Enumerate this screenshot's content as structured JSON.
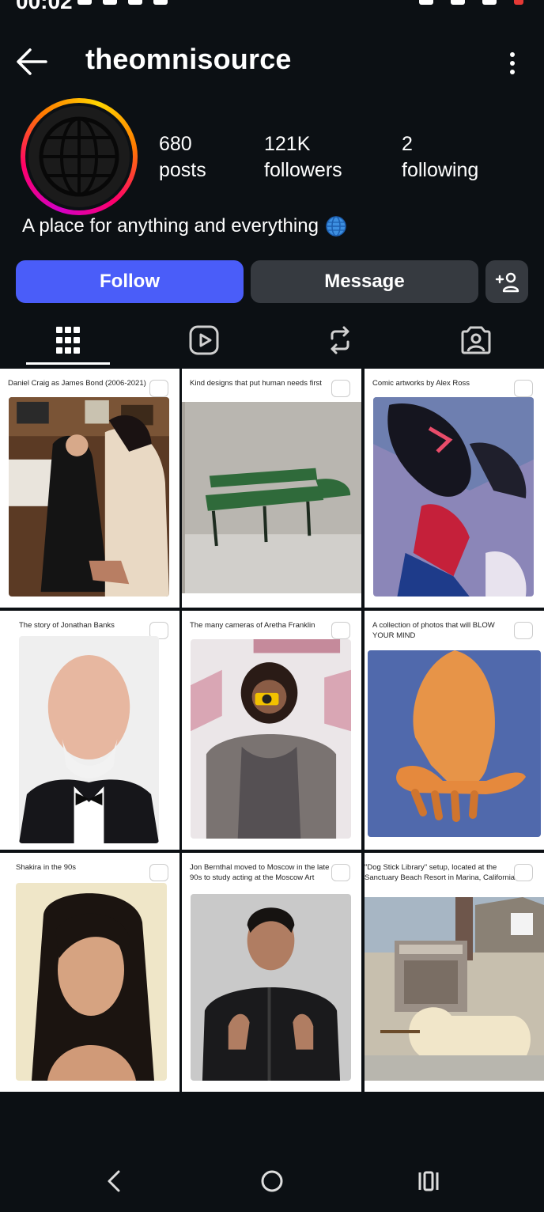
{
  "status": {
    "time": "00:02"
  },
  "header": {
    "username": "theomnisource"
  },
  "profile": {
    "posts_count": "680",
    "posts_label": "posts",
    "followers_count": "121K",
    "followers_label": "followers",
    "following_count": "2",
    "following_label": "following",
    "bio": "A place for anything and everything"
  },
  "actions": {
    "follow_label": "Follow",
    "message_label": "Message"
  },
  "tabs": [
    {
      "icon": "grid-icon",
      "active": true
    },
    {
      "icon": "reels-icon",
      "active": false
    },
    {
      "icon": "reposts-icon",
      "active": false
    },
    {
      "icon": "tagged-icon",
      "active": false
    }
  ],
  "posts": [
    {
      "caption": "Daniel Craig as James Bond (2006-2021)"
    },
    {
      "caption": "Kind designs that put human needs first"
    },
    {
      "caption": "Comic artworks by Alex Ross"
    },
    {
      "caption": "The story of Jonathan Banks"
    },
    {
      "caption": "The many cameras of Aretha Franklin"
    },
    {
      "caption": "A collection of photos that will BLOW YOUR MIND"
    },
    {
      "caption": "Shakira in the 90s"
    },
    {
      "caption": "Jon Bernthal moved to Moscow in the late 90s to study acting at the Moscow Art Theatre"
    },
    {
      "caption": "\"Dog Stick Library\" setup, located at the Sanctuary Beach Resort in Marina, California"
    }
  ],
  "colors": {
    "follow_button": "#4a5df9",
    "secondary_button": "#363a40",
    "background": "#0c1014"
  }
}
